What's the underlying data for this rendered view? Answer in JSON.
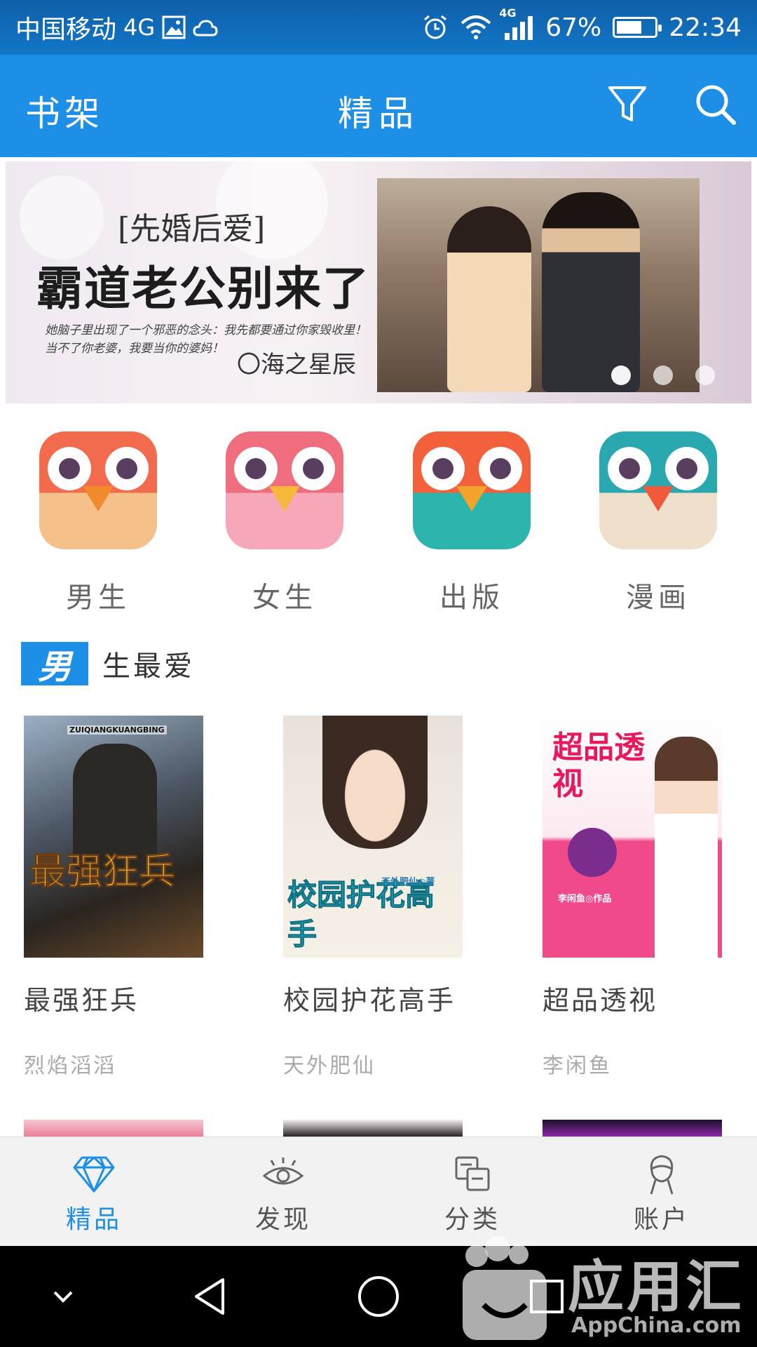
{
  "status_bar": {
    "carrier": "中国移动",
    "network": "4G",
    "signal_network": "4G",
    "battery": "67%",
    "battery_level": 0.67,
    "time": "22:34"
  },
  "app_bar": {
    "left_label": "书架",
    "title": "精品",
    "filter_icon": "filter-icon",
    "search_icon": "search-icon"
  },
  "banner": {
    "tag": "[先婚后爱]",
    "title": "霸道老公别来了",
    "lines": [
      "她脑子里出现了一个邪恶的念头：我先都要通过你家毁收里！",
      "当不了你老婆，我要当你的婆妈！"
    ],
    "author": "〇海之星辰",
    "page_count": 3,
    "active_page": 1
  },
  "categories": [
    {
      "label": "男生",
      "colors": {
        "bg": "#f6c08a",
        "top": "#f26b4d",
        "beak": "#f08a2a"
      }
    },
    {
      "label": "女生",
      "colors": {
        "bg": "#f7a8b8",
        "top": "#ef6d7d",
        "beak": "#f6b73a"
      }
    },
    {
      "label": "出版",
      "colors": {
        "bg": "#2bb5ad",
        "top": "#f2603c",
        "beak": "#f3a22a"
      }
    },
    {
      "label": "漫画",
      "colors": {
        "bg": "#efe0cc",
        "top": "#2aa8b0",
        "beak": "#f05a3a"
      }
    }
  ],
  "section": {
    "badge": "男",
    "rest": "生最爱"
  },
  "books": [
    {
      "title": "最强狂兵",
      "author": "烈焰滔滔",
      "cover_text": "最强狂兵",
      "cover_caption": "ZUIQIANGKUANGBING"
    },
    {
      "title": "校园护花高手",
      "author": "天外肥仙",
      "cover_text": "校园护花高手",
      "cover_caption": "天外肥仙◎著"
    },
    {
      "title": "超品透视",
      "author": "李闲鱼",
      "cover_text": "超品透视",
      "cover_caption": "李闲鱼◎作品"
    }
  ],
  "bottom_nav": [
    {
      "label": "精品",
      "icon": "diamond-icon",
      "active": true
    },
    {
      "label": "发现",
      "icon": "eye-icon",
      "active": false
    },
    {
      "label": "分类",
      "icon": "category-icon",
      "active": false
    },
    {
      "label": "账户",
      "icon": "user-icon",
      "active": false
    }
  ],
  "system_nav": [
    "chevron-down-icon",
    "back-icon",
    "home-icon",
    "recents-icon"
  ],
  "watermark": {
    "text": "应用汇",
    "sub": "AppChina.com"
  },
  "colors": {
    "primary": "#1e8fe6",
    "status_bar": "#1277c8"
  }
}
